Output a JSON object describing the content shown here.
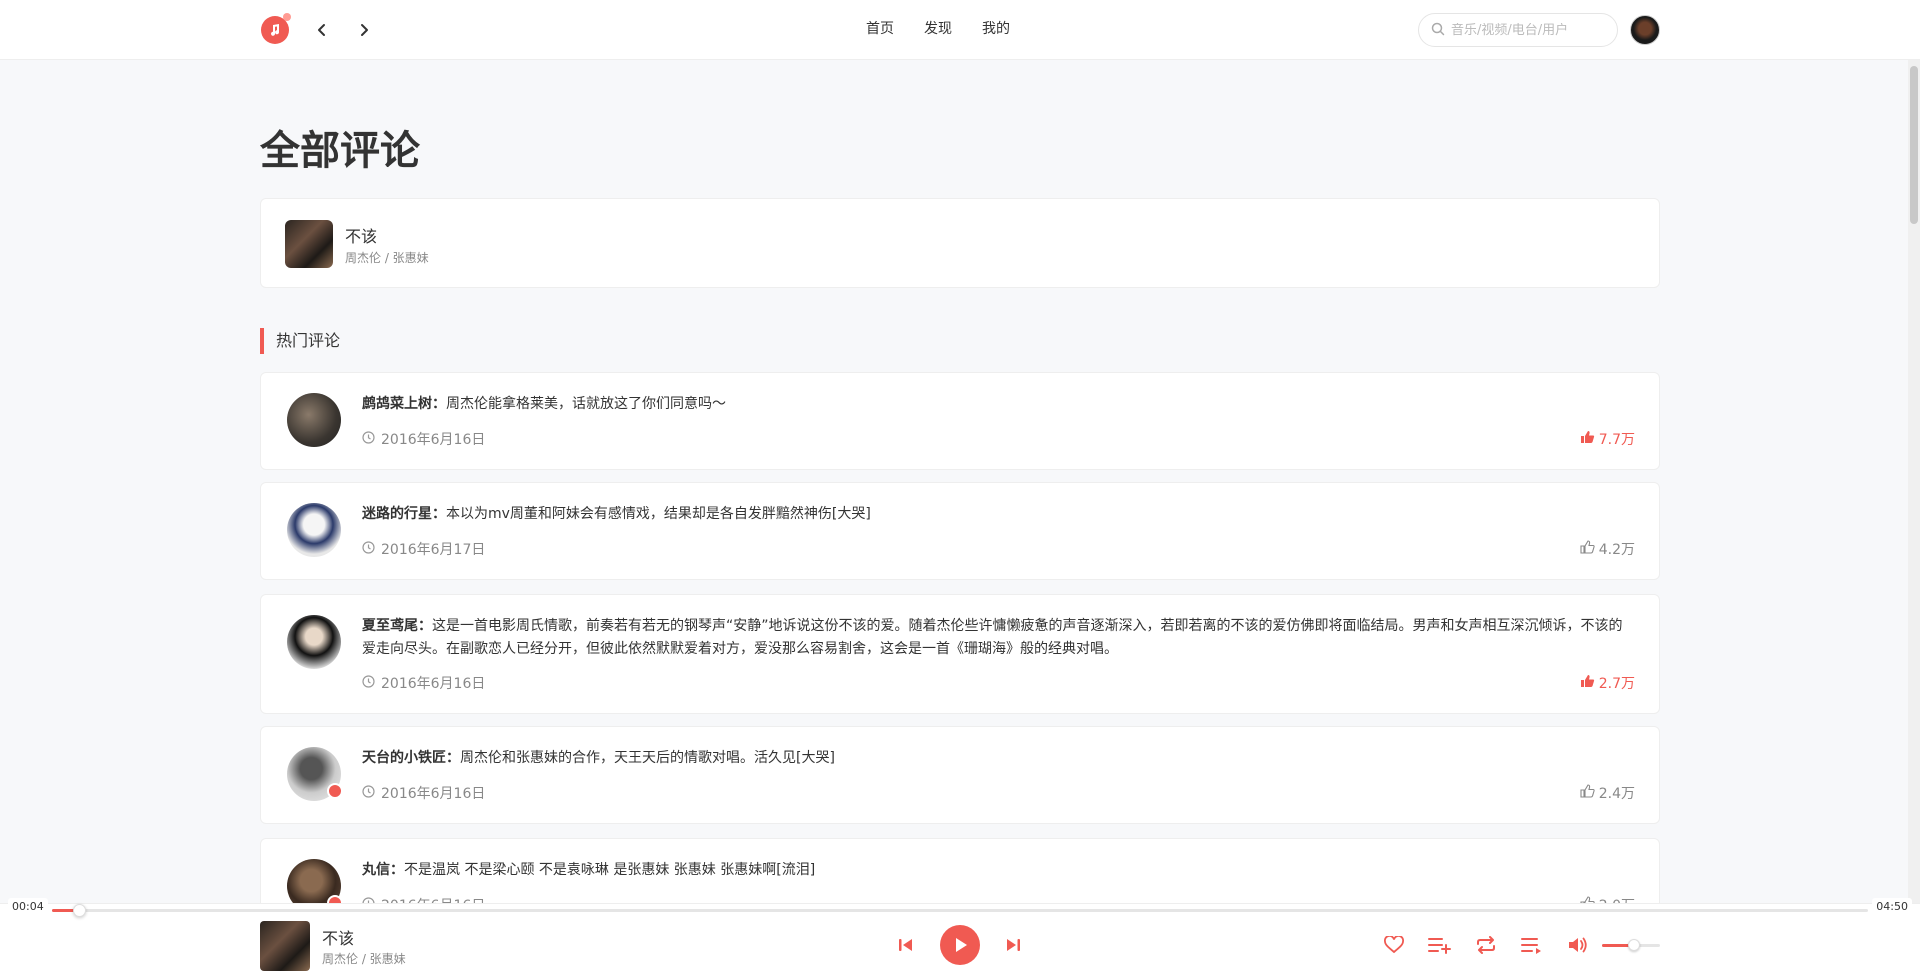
{
  "header": {
    "nav": [
      {
        "label": "首页"
      },
      {
        "label": "发现"
      },
      {
        "label": "我的"
      }
    ],
    "search_placeholder": "音乐/视频/电台/用户",
    "icons": {
      "logo": "music-note-logo",
      "back": "chevron-left-icon",
      "forward": "chevron-right-icon",
      "search": "search-icon"
    }
  },
  "page": {
    "title": "全部评论"
  },
  "song": {
    "name": "不该",
    "artist": "周杰伦 / 张惠妹"
  },
  "hot_section": {
    "title": "热门评论"
  },
  "comments": [
    {
      "user": "鹧鸪菜上树：",
      "content": "周杰伦能拿格莱美，话就放这了你们同意吗～",
      "date": "2016年6月16日",
      "likes": "7.7万",
      "liked": true
    },
    {
      "user": "迷路的行星：",
      "content": "本以为mv周董和阿妹会有感情戏，结果却是各自发胖黯然神伤[大哭]",
      "date": "2016年6月17日",
      "likes": "4.2万",
      "liked": false
    },
    {
      "user": "夏至鸢尾：",
      "content": "这是一首电影周氏情歌，前奏若有若无的钢琴声“安静”地诉说这份不该的爱。随着杰伦些许慵懒疲惫的声音逐渐深入，若即若离的不该的爱仿佛即将面临结局。男声和女声相互深沉倾诉，不该的爱走向尽头。在副歌恋人已经分开，但彼此依然默默爱着对方，爱没那么容易割舍，这会是一首《珊瑚海》般的经典对唱。",
      "date": "2016年6月16日",
      "likes": "2.7万",
      "liked": true
    },
    {
      "user": "天台的小铁匠：",
      "content": "周杰伦和张惠妹的合作，天王天后的情歌对唱。活久见[大哭]",
      "date": "2016年6月16日",
      "likes": "2.4万",
      "liked": false
    },
    {
      "user": "丸信：",
      "content": "不是温岚 不是梁心颐 不是袁咏琳 是张惠妹 张惠妹 张惠妹啊[流泪]",
      "date": "2016年6月16日",
      "likes": "2.0万",
      "liked": false
    }
  ],
  "player": {
    "current_time": "00:04",
    "total_time": "04:50",
    "progress": 0.015,
    "song_name": "不该",
    "artist": "周杰伦 / 张惠妹",
    "volume": 0.55
  },
  "colors": {
    "accent": "#f05a52",
    "text": "#333333",
    "muted": "#888888",
    "background": "#f7f8fa"
  }
}
